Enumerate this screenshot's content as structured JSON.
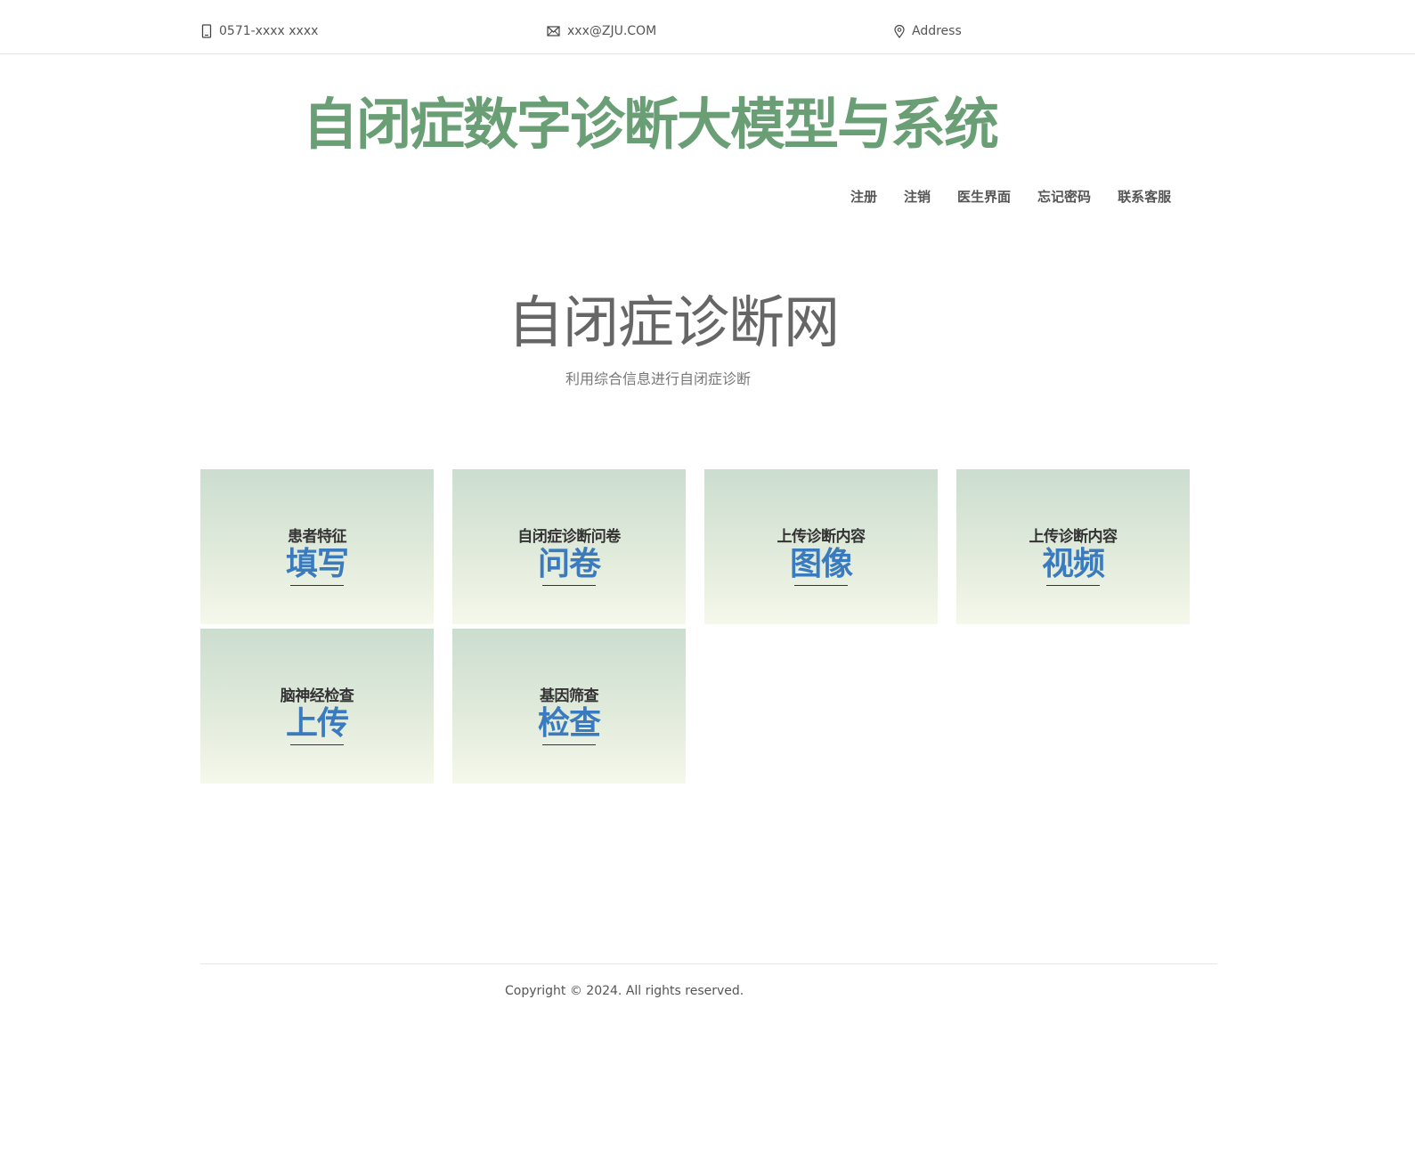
{
  "contact": {
    "phone": "0571-xxxx xxxx",
    "email": "xxx@ZJU.COM",
    "address": "Address"
  },
  "site_title": "自闭症数字诊断大模型与系统",
  "nav": {
    "items": [
      {
        "label": "注册"
      },
      {
        "label": "注销"
      },
      {
        "label": "医生界面"
      },
      {
        "label": "忘记密码"
      },
      {
        "label": "联系客服"
      }
    ]
  },
  "hero": {
    "title": "自闭症诊断网",
    "subtitle": "利用综合信息进行自闭症诊断"
  },
  "cards": [
    {
      "small": "患者特征",
      "big": "填写"
    },
    {
      "small": "自闭症诊断问卷",
      "big": "问卷"
    },
    {
      "small": "上传诊断内容",
      "big": "图像"
    },
    {
      "small": "上传诊断内容",
      "big": "视频"
    },
    {
      "small": "脑神经检查",
      "big": "上传"
    },
    {
      "small": "基因筛查",
      "big": "检查"
    }
  ],
  "footer": {
    "copyright": "Copyright © 2024. All rights reserved."
  },
  "colors": {
    "title_green": "#6a9f76",
    "card_big_blue": "#3a7bbf",
    "card_gradient_top": "#cbddcf",
    "card_gradient_bottom": "#f5f8ea"
  }
}
